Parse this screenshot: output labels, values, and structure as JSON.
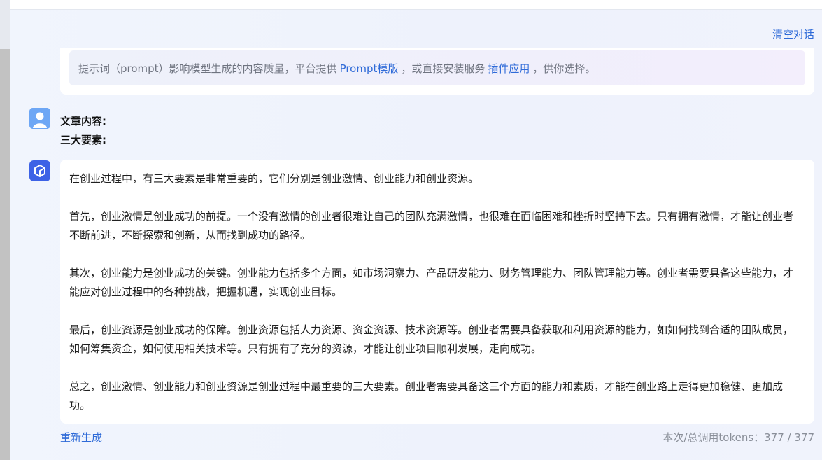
{
  "header": {
    "clear_label": "清空对话"
  },
  "hint": {
    "text_before": "提示词（prompt）影响模型生成的内容质量，平台提供",
    "link1": "Prompt模版",
    "text_middle": "，或直接安装服务",
    "link2": "插件应用",
    "text_after": "，供你选择。"
  },
  "user_message": {
    "line1": "文章内容:",
    "line2": "三大要素:"
  },
  "answer": {
    "paragraphs": [
      "在创业过程中，有三大要素是非常重要的，它们分别是创业激情、创业能力和创业资源。",
      "首先，创业激情是创业成功的前提。一个没有激情的创业者很难让自己的团队充满激情，也很难在面临困难和挫折时坚持下去。只有拥有激情，才能让创业者不断前进，不断探索和创新，从而找到成功的路径。",
      "其次，创业能力是创业成功的关键。创业能力包括多个方面，如市场洞察力、产品研发能力、财务管理能力、团队管理能力等。创业者需要具备这些能力，才能应对创业过程中的各种挑战，把握机遇，实现创业目标。",
      "最后，创业资源是创业成功的保障。创业资源包括人力资源、资金资源、技术资源等。创业者需要具备获取和利用资源的能力，如如何找到合适的团队成员，如何筹集资金，如何使用相关技术等。只有拥有了充分的资源，才能让创业项目顺利发展，走向成功。",
      "总之，创业激情、创业能力和创业资源是创业过程中最重要的三大要素。创业者需要具备这三个方面的能力和素质，才能在创业路上走得更加稳健、更加成功。"
    ]
  },
  "footer": {
    "regenerate_label": "重新生成",
    "tokens_label": "本次/总调用tokens：377 / 377"
  },
  "icons": {
    "user_avatar": "user-avatar-icon",
    "bot_avatar": "cube-logo-icon"
  },
  "colors": {
    "link": "#2f6bd8",
    "bot_avatar_bg": "#3d62e6",
    "user_avatar_bg": "#6ea7f5"
  }
}
